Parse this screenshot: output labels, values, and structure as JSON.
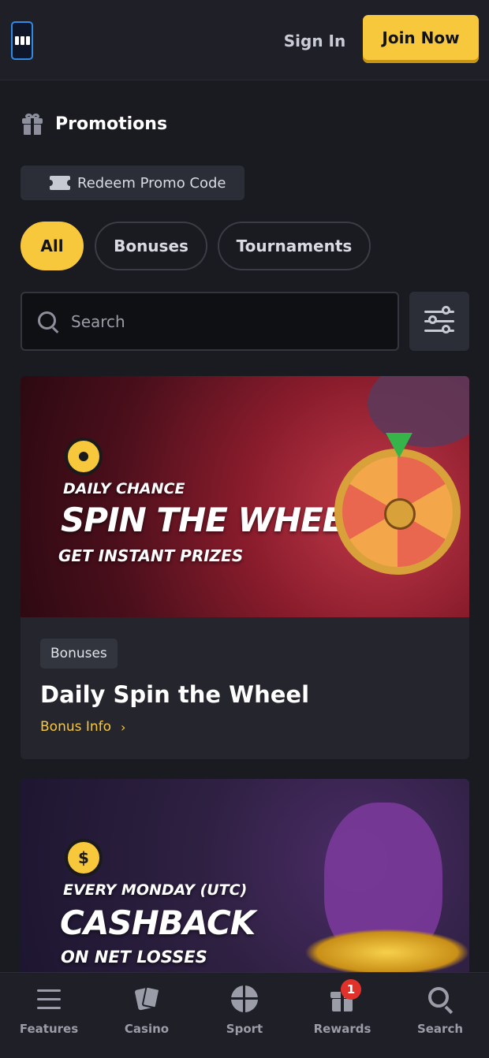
{
  "header": {
    "logo": "logo",
    "sign_in_label": "Sign In",
    "join_label": "Join Now"
  },
  "promotions": {
    "title": "Promotions",
    "redeem_label": "Redeem Promo Code"
  },
  "filters": {
    "chips": [
      {
        "label": "All",
        "active": true
      },
      {
        "label": "Bonuses",
        "active": false
      },
      {
        "label": "Tournaments",
        "active": false
      }
    ]
  },
  "search": {
    "placeholder": "Search"
  },
  "cards": [
    {
      "banner_top": "DAILY CHANCE",
      "banner_main": "SPIN THE WHEEL",
      "banner_bottom": "GET INSTANT PRIZES",
      "tag": "Bonuses",
      "title": "Daily Spin the Wheel",
      "link": "Bonus Info"
    },
    {
      "banner_top": "EVERY MONDAY (UTC)",
      "banner_main": "CASHBACK",
      "banner_bottom": "ON NET LOSSES",
      "badge_symbol": "$"
    }
  ],
  "bottom_nav": {
    "items": [
      {
        "label": "Features",
        "icon": "menu-icon"
      },
      {
        "label": "Casino",
        "icon": "cards-icon"
      },
      {
        "label": "Sport",
        "icon": "basketball-icon"
      },
      {
        "label": "Rewards",
        "icon": "gift-icon",
        "badge": "1"
      },
      {
        "label": "Search",
        "icon": "search-icon"
      }
    ]
  },
  "colors": {
    "accent": "#f8c83c",
    "background": "#1a1b21",
    "badge_red": "#e0322a"
  }
}
